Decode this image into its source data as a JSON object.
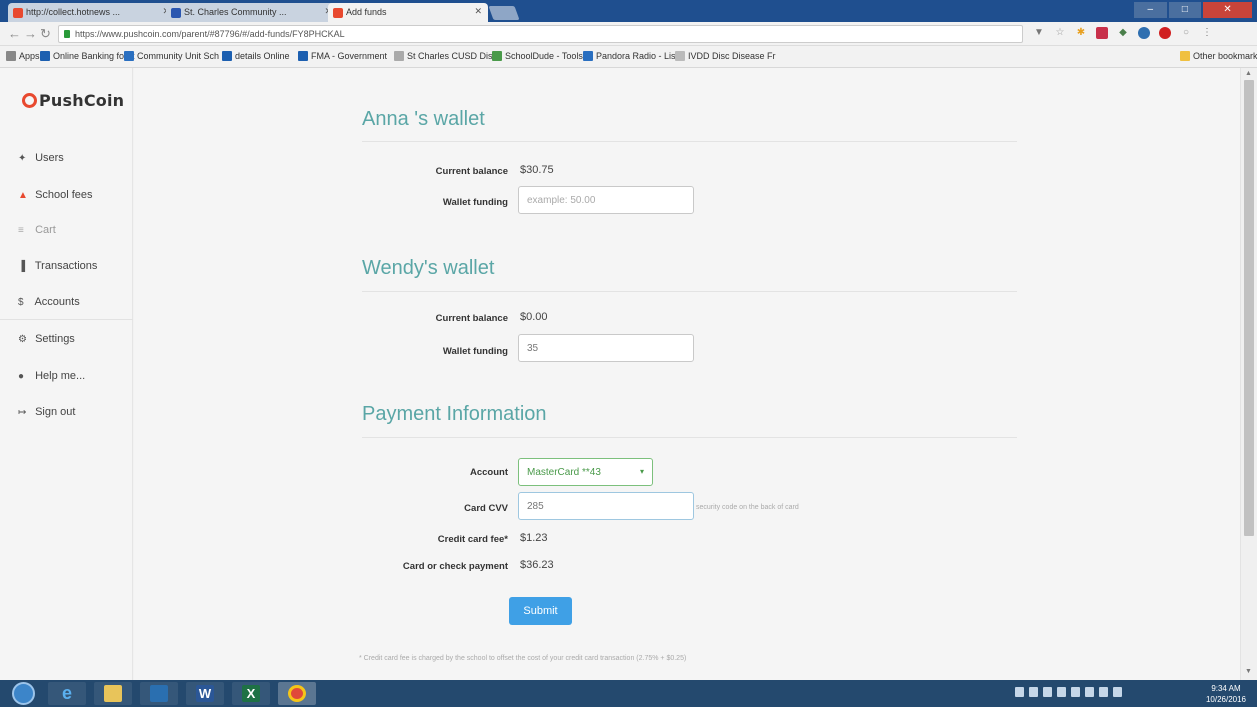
{
  "browser": {
    "tabs": [
      {
        "label": "http://collect.hotnews ...",
        "fav_color": "#e8492f"
      },
      {
        "label": "St. Charles Community ...",
        "fav_color": "#2a56b0"
      },
      {
        "label": "Add funds",
        "fav_color": "#e8492f"
      }
    ],
    "url": "https://www.pushcoin.com/parent/#87796/#/add-funds/FY8PHCKAL",
    "bookmarks": [
      {
        "label": "Apps",
        "color": "#555"
      },
      {
        "label": "Online Banking for It",
        "color": "#1c5fb0"
      },
      {
        "label": "Community Unit Sch",
        "color": "#2a6fc0"
      },
      {
        "label": "details Online",
        "color": "#1c5fb0"
      },
      {
        "label": "FMA - Government",
        "color": "#1c5fb0"
      },
      {
        "label": "St Charles CUSD Dis",
        "color": "#888"
      },
      {
        "label": "SchoolDude - Tools",
        "color": "#4a9a4a"
      },
      {
        "label": "Pandora Radio - Lis",
        "color": "#2a6fc0"
      },
      {
        "label": "IVDD Disc Disease Fr",
        "color": "#888"
      }
    ],
    "other_bookmarks": "Other bookmarks"
  },
  "app": {
    "brand": "PushCoin",
    "nav": [
      {
        "label": "Users",
        "icon": "users-icon",
        "glyph": "✦"
      },
      {
        "label": "School fees",
        "icon": "bell-icon",
        "glyph": "▲"
      },
      {
        "label": "Cart",
        "icon": "cart-icon",
        "glyph": "≡"
      },
      {
        "label": "Transactions",
        "icon": "bar-chart-icon",
        "glyph": "▐"
      },
      {
        "label": "Accounts",
        "icon": "dollar-icon",
        "glyph": "$"
      },
      {
        "label": "Settings",
        "icon": "gears-icon",
        "glyph": "⚙"
      },
      {
        "label": "Help me...",
        "icon": "help-icon",
        "glyph": "●"
      },
      {
        "label": "Sign out",
        "icon": "sign-out-icon",
        "glyph": "↦"
      }
    ]
  },
  "wallets": [
    {
      "title": "Anna 's wallet",
      "balance_label": "Current balance",
      "balance": "$30.75",
      "funding_label": "Wallet funding",
      "funding_value": "",
      "funding_placeholder": "example: 50.00"
    },
    {
      "title": "Wendy's wallet",
      "balance_label": "Current balance",
      "balance": "$0.00",
      "funding_label": "Wallet funding",
      "funding_value": "35",
      "funding_placeholder": ""
    }
  ],
  "payment": {
    "title": "Payment Information",
    "account_label": "Account",
    "account_value": "MasterCard **43",
    "cvv_label": "Card CVV",
    "cvv_value": "285",
    "cvv_hint": "security code on the back of card",
    "fee_label": "Credit card fee*",
    "fee_value": "$1.23",
    "total_label": "Card or check payment",
    "total_value": "$36.23",
    "submit_label": "Submit",
    "footnote": "* Credit card fee is charged by the school to offset the cost of your credit card transaction (2.75% + $0.25)"
  },
  "taskbar": {
    "time": "9:34 AM",
    "date": "10/26/2016"
  },
  "colors": {
    "accent_teal": "#5aa6a6",
    "submit_blue": "#3fa0e6",
    "brand_red": "#e8492f"
  }
}
